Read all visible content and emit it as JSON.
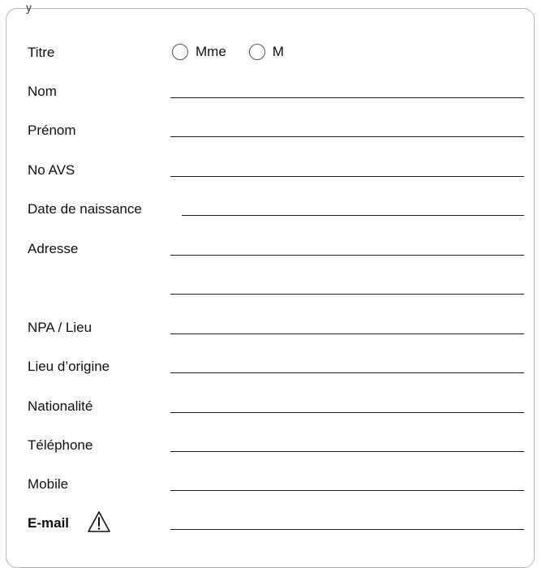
{
  "header": {
    "fragment": "y"
  },
  "title_field": {
    "label": "Titre",
    "options": [
      "Mme",
      "M"
    ]
  },
  "fields": [
    {
      "label": "Nom"
    },
    {
      "label": "Prénom"
    },
    {
      "label": "No AVS"
    },
    {
      "label": "Date de naissance"
    },
    {
      "label": "Adresse"
    },
    {
      "label": ""
    },
    {
      "label": "NPA / Lieu"
    },
    {
      "label": "Lieu d’origine"
    },
    {
      "label": "Nationalité"
    },
    {
      "label": "Téléphone"
    },
    {
      "label": "Mobile"
    },
    {
      "label": "E-mail"
    }
  ],
  "icons": {
    "email_warning": "warning-triangle-icon"
  },
  "colors": {
    "border": "#b8b8b8",
    "text": "#111111"
  }
}
